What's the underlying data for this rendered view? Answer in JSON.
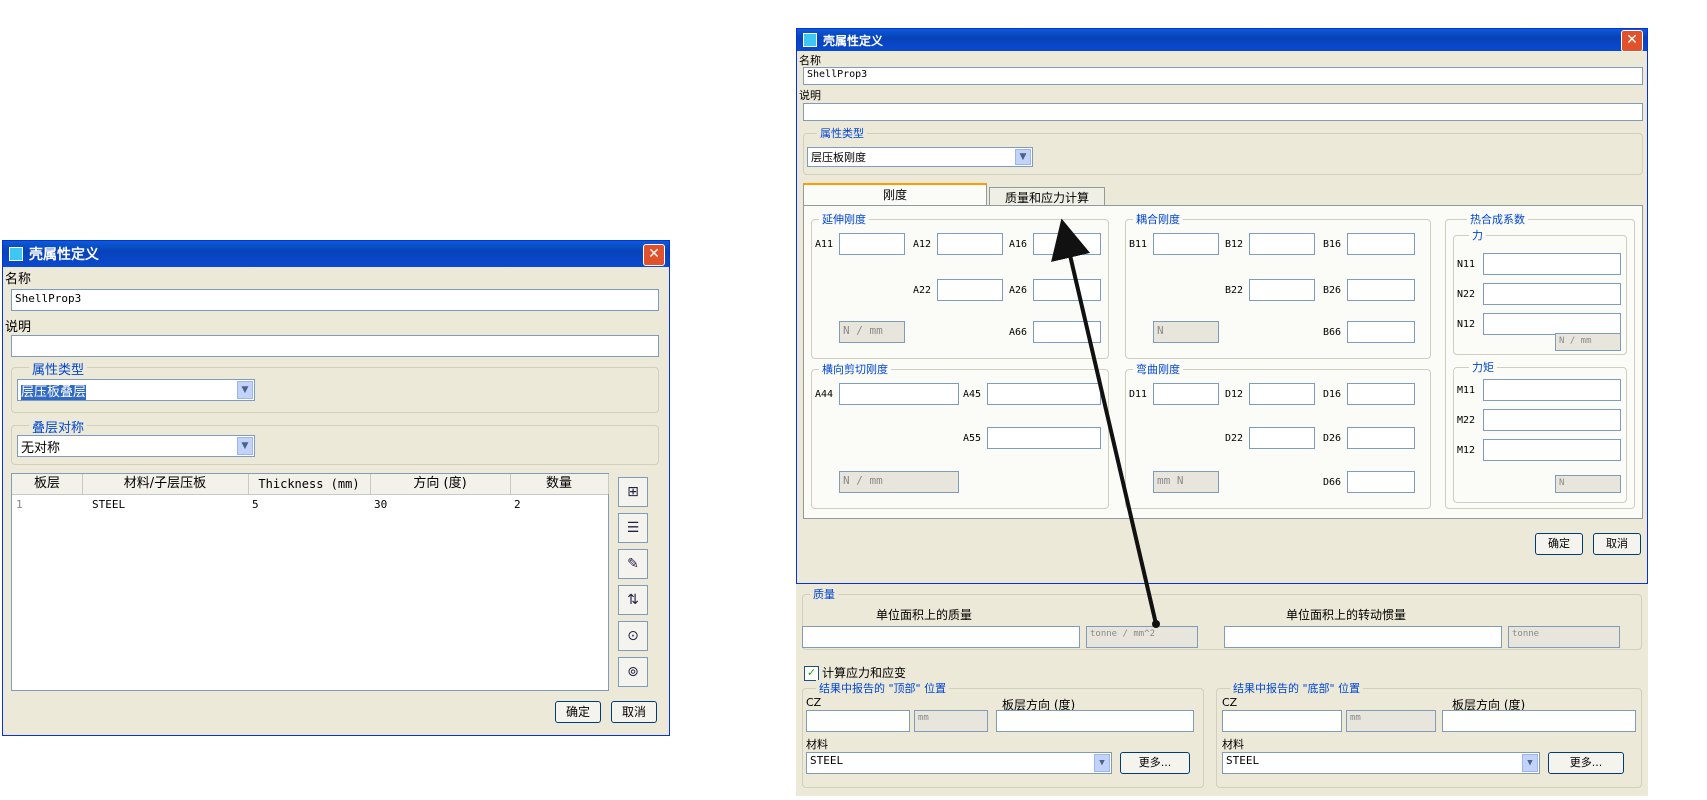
{
  "left_dialog": {
    "title": "壳属性定义",
    "name_label": "名称",
    "name_value": "ShellProp3",
    "desc_label": "说明",
    "desc_value": "",
    "prop_type_label": "属性类型",
    "prop_type_value": "层压板叠层",
    "sym_label": "叠层对称",
    "sym_value": "无对称",
    "columns": [
      "板层",
      "材料/子层压板",
      "Thickness (mm)",
      "方向 (度)",
      "数量"
    ],
    "rows": [
      [
        "1",
        "STEEL",
        "5",
        "30",
        "2"
      ]
    ],
    "ok_label": "确定",
    "cancel_label": "取消"
  },
  "right_dialog": {
    "title": "壳属性定义",
    "name_label": "名称",
    "name_value": "ShellProp3",
    "desc_label": "说明",
    "desc_value": "",
    "prop_type_label": "属性类型",
    "prop_type_value": "层压板刚度",
    "tabs": [
      "刚度",
      "质量和应力计算"
    ],
    "stretch_label": "延伸刚度",
    "coupling_label": "耦合刚度",
    "thermal_label": "热合成系数",
    "force_label": "力",
    "shear_label": "横向剪切刚度",
    "bending_label": "弯曲刚度",
    "moment_label": "力矩",
    "a_labels": [
      "A11",
      "A12",
      "A16",
      "A22",
      "A26",
      "A66"
    ],
    "b_labels": [
      "B11",
      "B12",
      "B16",
      "B22",
      "B26",
      "B66"
    ],
    "n_labels": [
      "N11",
      "N22",
      "N12"
    ],
    "as_labels": [
      "A44",
      "A45",
      "A55"
    ],
    "d_labels": [
      "D11",
      "D12",
      "D16",
      "D22",
      "D26",
      "D66"
    ],
    "m_labels": [
      "M11",
      "M22",
      "M12"
    ],
    "unit_n_mm": "N / mm",
    "unit_n": "N",
    "unit_mm_n": "mm N",
    "ok_label": "确定",
    "cancel_label": "取消"
  },
  "mass_panel": {
    "mass_label": "质量",
    "mass_per_area": "单位面积上的质量",
    "mass_unit": "tonne / mm^2",
    "inertia_per_area": "单位面积上的转动惯量",
    "inertia_unit": "tonne",
    "calc_stress_label": "计算应力和应变",
    "top_label": "结果中报告的 \"顶部\" 位置",
    "bottom_label": "结果中报告的 \"底部\" 位置",
    "cz_label": "CZ",
    "cz_unit": "mm",
    "ply_dir_label": "板层方向 (度)",
    "material_label": "材料",
    "material_value": "STEEL",
    "more_label": "更多..."
  }
}
